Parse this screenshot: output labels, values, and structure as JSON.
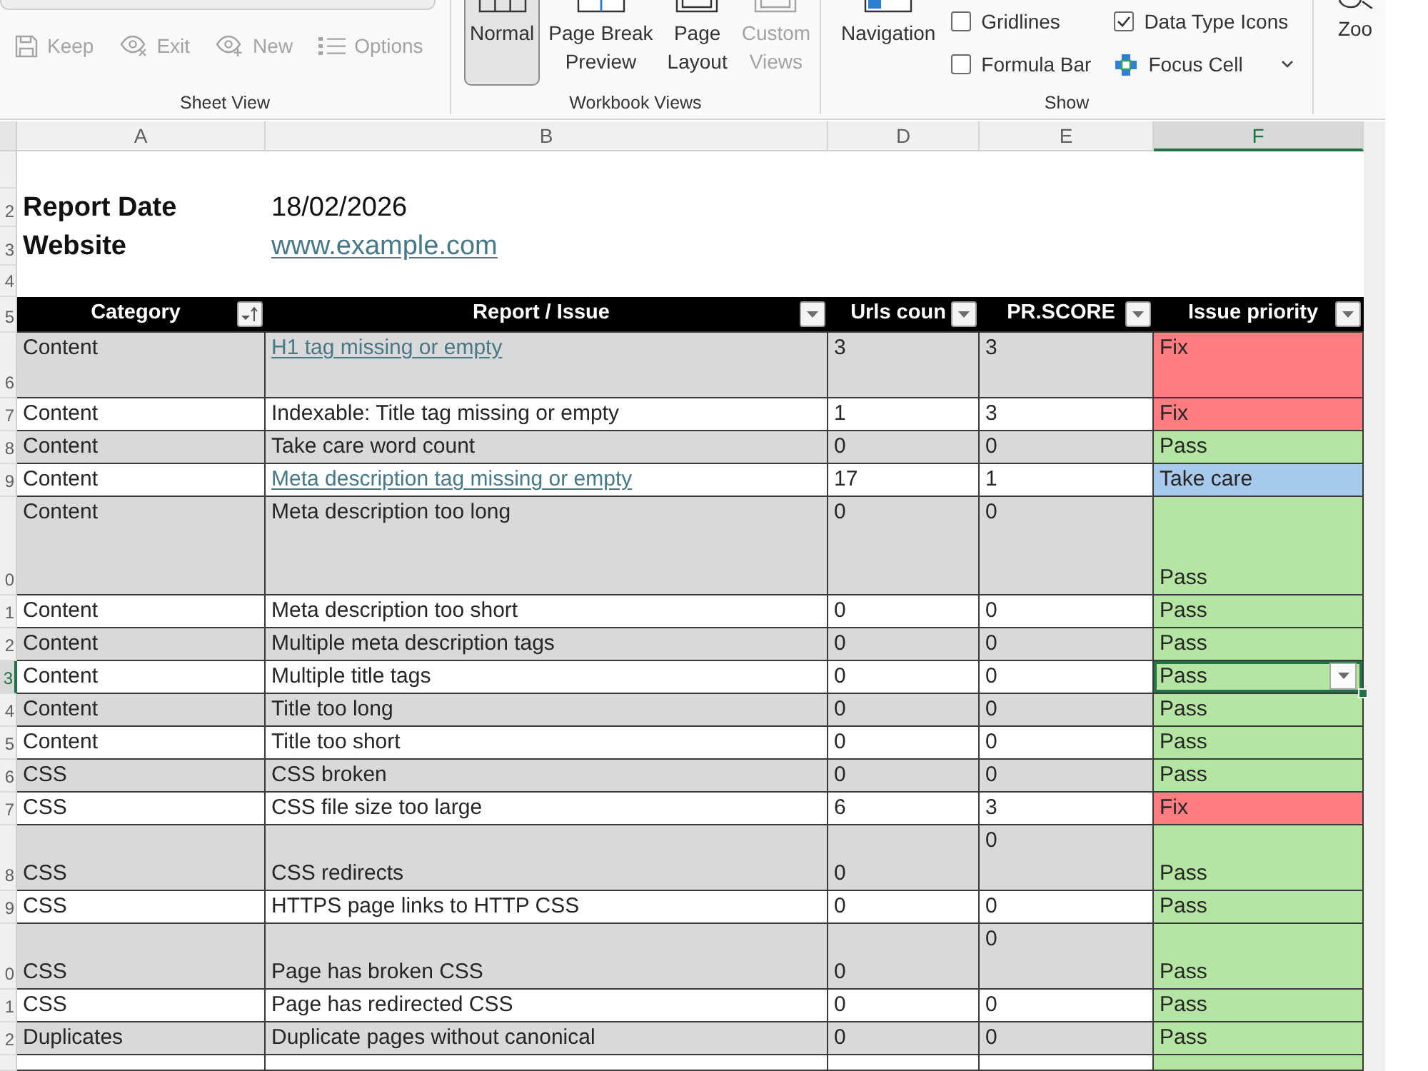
{
  "ribbon": {
    "sheet_view": {
      "label": "Sheet View",
      "buttons": [
        {
          "label": "Keep",
          "disabled": true
        },
        {
          "label": "Exit",
          "disabled": true
        },
        {
          "label": "New",
          "disabled": true
        },
        {
          "label": "Options",
          "disabled": true
        }
      ]
    },
    "workbook_views": {
      "label": "Workbook Views",
      "buttons": [
        {
          "label": "Normal",
          "selected": true,
          "disabled": false
        },
        {
          "label": "Page Break\nPreview",
          "selected": false,
          "disabled": false
        },
        {
          "label": "Page\nLayout",
          "selected": false,
          "disabled": false
        },
        {
          "label": "Custom\nViews",
          "selected": false,
          "disabled": true
        }
      ]
    },
    "show": {
      "label": "Show",
      "navigation": "Navigation",
      "options": [
        {
          "kind": "checkbox",
          "label": "Gridlines",
          "checked": false
        },
        {
          "kind": "checkbox",
          "label": "Formula Bar",
          "checked": false
        },
        {
          "kind": "checkbox",
          "label": "Data Type Icons",
          "checked": true
        },
        {
          "kind": "focus",
          "label": "Focus Cell"
        }
      ]
    },
    "zoom": {
      "label": "Zoo"
    }
  },
  "sheet": {
    "columns": [
      {
        "label": "A",
        "selected": false
      },
      {
        "label": "B",
        "selected": false
      },
      {
        "label": "D",
        "selected": false
      },
      {
        "label": "E",
        "selected": false
      },
      {
        "label": "F",
        "selected": true
      }
    ],
    "rows": [
      {
        "kind": "blank"
      },
      {
        "kind": "info",
        "number": "2",
        "label": "Report Date",
        "value": "18/02/2026",
        "link": false
      },
      {
        "kind": "info",
        "number": "3",
        "label": "Website",
        "value": "www.example.com",
        "link": true
      },
      {
        "kind": "blank",
        "number": "4"
      },
      {
        "kind": "header",
        "number": "5",
        "cells": [
          {
            "label": "Category",
            "sorted": true
          },
          {
            "label": "Report / Issue",
            "sorted": false
          },
          {
            "label": "Urls coun",
            "sorted": false
          },
          {
            "label": "PR.SCORE",
            "sorted": false
          },
          {
            "label": "Issue priority",
            "sorted": false
          }
        ]
      },
      {
        "kind": "data",
        "number": "6",
        "category": "Content",
        "issue": "H1 tag missing or empty",
        "link": true,
        "urls_count": "3",
        "pr_score": "3",
        "priority": "Fix",
        "color": "#ff7c80",
        "selected": false
      },
      {
        "kind": "data",
        "number": "7",
        "category": "Content",
        "issue": "Indexable: Title tag missing or empty",
        "link": false,
        "urls_count": "1",
        "pr_score": "3",
        "priority": "Fix",
        "color": "#ff7c80",
        "selected": false
      },
      {
        "kind": "data",
        "number": "8",
        "category": "Content",
        "issue": "Take care word count",
        "link": false,
        "urls_count": "0",
        "pr_score": "0",
        "priority": "Pass",
        "color": "#b4e5a2",
        "selected": false
      },
      {
        "kind": "data",
        "number": "9",
        "category": "Content",
        "issue": "Meta description tag missing or empty",
        "link": true,
        "urls_count": "17",
        "pr_score": "1",
        "priority": "Take care",
        "color": "#a6c9ec",
        "selected": false
      },
      {
        "kind": "data",
        "number": "0",
        "category": "Content",
        "issue": "Meta description too long",
        "link": false,
        "urls_count": "0",
        "pr_score": "0",
        "priority": "Pass",
        "color": "#b4e5a2",
        "selected": false
      },
      {
        "kind": "data",
        "number": "1",
        "category": "Content",
        "issue": "Meta description too short",
        "link": false,
        "urls_count": "0",
        "pr_score": "0",
        "priority": "Pass",
        "color": "#b4e5a2",
        "selected": false
      },
      {
        "kind": "data",
        "number": "2",
        "category": "Content",
        "issue": "Multiple meta description tags",
        "link": false,
        "urls_count": "0",
        "pr_score": "0",
        "priority": "Pass",
        "color": "#b4e5a2",
        "selected": false
      },
      {
        "kind": "data",
        "number": "3",
        "category": "Content",
        "issue": "Multiple title tags",
        "link": false,
        "urls_count": "0",
        "pr_score": "0",
        "priority": "Pass",
        "color": "#b4e5a2",
        "selected": true
      },
      {
        "kind": "data",
        "number": "4",
        "category": "Content",
        "issue": "Title too long",
        "link": false,
        "urls_count": "0",
        "pr_score": "0",
        "priority": "Pass",
        "color": "#b4e5a2",
        "selected": false
      },
      {
        "kind": "data",
        "number": "5",
        "category": "Content",
        "issue": "Title too short",
        "link": false,
        "urls_count": "0",
        "pr_score": "0",
        "priority": "Pass",
        "color": "#b4e5a2",
        "selected": false
      },
      {
        "kind": "data",
        "number": "6",
        "category": "CSS",
        "issue": "CSS broken",
        "link": false,
        "urls_count": "0",
        "pr_score": "0",
        "priority": "Pass",
        "color": "#b4e5a2",
        "selected": false
      },
      {
        "kind": "data",
        "number": "7",
        "category": "CSS",
        "issue": "CSS file size too large",
        "link": false,
        "urls_count": "6",
        "pr_score": "3",
        "priority": "Fix",
        "color": "#ff7c80",
        "selected": false
      },
      {
        "kind": "data",
        "number": "8",
        "category": "CSS",
        "issue": "CSS redirects",
        "link": false,
        "urls_count": "0",
        "pr_score": "0",
        "priority": "Pass",
        "color": "#b4e5a2",
        "selected": false
      },
      {
        "kind": "data",
        "number": "9",
        "category": "CSS",
        "issue": "HTTPS page links to HTTP CSS",
        "link": false,
        "urls_count": "0",
        "pr_score": "0",
        "priority": "Pass",
        "color": "#b4e5a2",
        "selected": false
      },
      {
        "kind": "data",
        "number": "0",
        "category": "CSS",
        "issue": "Page has broken CSS",
        "link": false,
        "urls_count": "0",
        "pr_score": "0",
        "priority": "Pass",
        "color": "#b4e5a2",
        "selected": false
      },
      {
        "kind": "data",
        "number": "1",
        "category": "CSS",
        "issue": "Page has redirected CSS",
        "link": false,
        "urls_count": "0",
        "pr_score": "0",
        "priority": "Pass",
        "color": "#b4e5a2",
        "selected": false
      },
      {
        "kind": "data",
        "number": "2",
        "category": "Duplicates",
        "issue": "Duplicate pages without canonical",
        "link": false,
        "urls_count": "0",
        "pr_score": "0",
        "priority": "Pass",
        "color": "#b4e5a2",
        "selected": false
      },
      {
        "kind": "cut",
        "color": "#b4e5a2",
        "selected": false
      }
    ]
  }
}
